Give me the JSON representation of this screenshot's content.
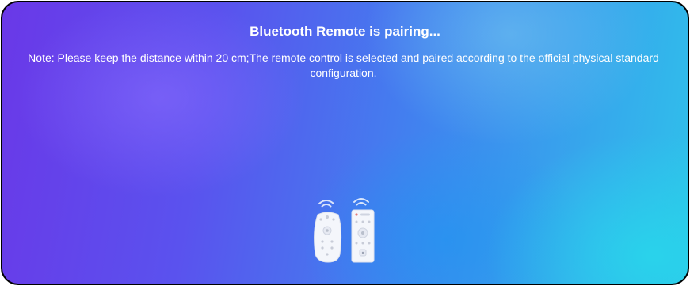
{
  "dialog": {
    "title": "Bluetooth Remote is pairing...",
    "note": "Note: Please keep the distance within 20 cm;The remote control is selected and paired according to the official physical standard configuration."
  },
  "illustration": {
    "icons": [
      "remote-rounded-icon",
      "remote-rectangular-icon",
      "wifi-signal-icon"
    ]
  }
}
